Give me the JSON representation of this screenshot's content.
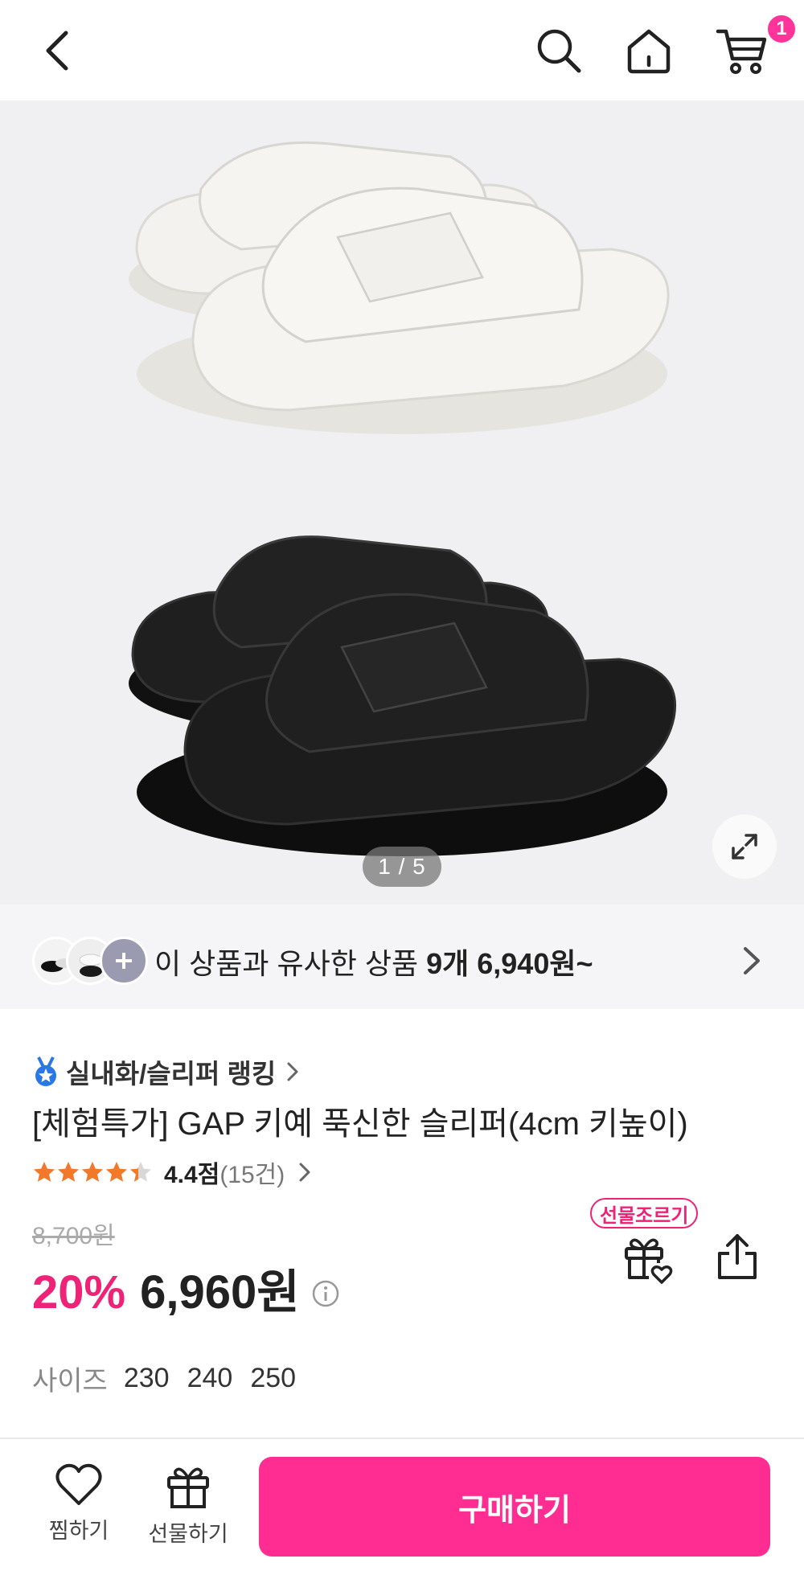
{
  "header": {
    "icons": [
      "back-icon",
      "search-icon",
      "home-icon",
      "cart-icon"
    ],
    "cart_count": "1"
  },
  "gallery": {
    "pager": "1 / 5",
    "product_colors": [
      "#f1efea",
      "#1c1c1c"
    ]
  },
  "similar": {
    "prefix": "이 상품과 유사한 상품 ",
    "count": "9개",
    "price": "6,940원~"
  },
  "product": {
    "ranking": "실내화/슬리퍼 랭킹",
    "title": "[체험특가] GAP 키예 푹신한 슬리퍼(4cm 키높이)",
    "rating_score": "4.4점",
    "rating_count": "(15건)",
    "rating_value": 4.4,
    "original_price": "8,700원",
    "discount": "20%",
    "price": "6,960원",
    "gift_tag": "선물조르기",
    "size_label": "사이즈",
    "sizes": [
      "230",
      "240",
      "250"
    ]
  },
  "bottom": {
    "wish_label": "찜하기",
    "gift_label": "선물하기",
    "buy_label": "구매하기"
  },
  "colors": {
    "accent": "#ff2d92",
    "discount": "#ee2277",
    "star": "#f2782a"
  }
}
